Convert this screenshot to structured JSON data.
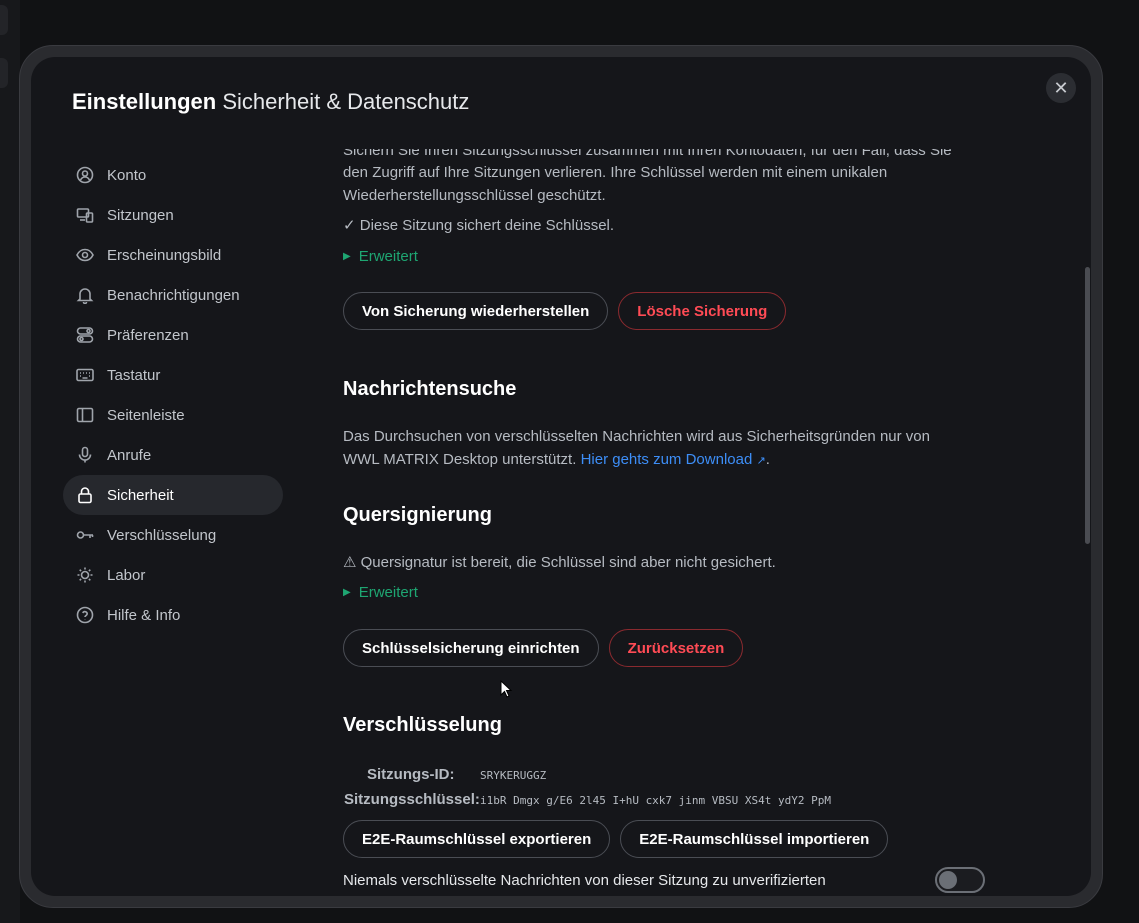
{
  "dialog": {
    "title_main": "Einstellungen",
    "title_sub": "Sicherheit & Datenschutz",
    "close_label": "✕"
  },
  "sidebar": {
    "items": [
      {
        "label": "Konto",
        "icon": "account-icon"
      },
      {
        "label": "Sitzungen",
        "icon": "devices-icon"
      },
      {
        "label": "Erscheinungsbild",
        "icon": "eye-icon"
      },
      {
        "label": "Benachrichtigungen",
        "icon": "bell-icon"
      },
      {
        "label": "Präferenzen",
        "icon": "preferences-icon"
      },
      {
        "label": "Tastatur",
        "icon": "keyboard-icon"
      },
      {
        "label": "Seitenleiste",
        "icon": "sidebar-icon"
      },
      {
        "label": "Anrufe",
        "icon": "microphone-icon"
      },
      {
        "label": "Sicherheit",
        "icon": "lock-icon",
        "active": true
      },
      {
        "label": "Verschlüsselung",
        "icon": "key-icon"
      },
      {
        "label": "Labor",
        "icon": "lightbulb-icon"
      },
      {
        "label": "Hilfe & Info",
        "icon": "help-icon"
      }
    ]
  },
  "backup": {
    "text_cut": "Sichern Sie Ihren Sitzungsschlüssel zusammen mit Ihren Kontodaten, für den Fall, dass Sie",
    "text_line2": "den Zugriff auf Ihre Sitzungen verlieren. Ihre Schlüssel werden mit einem unikalen",
    "text_line3": "Wiederherstellungsschlüssel geschützt.",
    "status": "✓ Diese Sitzung sichert deine Schlüssel.",
    "advanced": "Erweitert",
    "restore_button": "Von Sicherung wiederherstellen",
    "delete_button": "Lösche Sicherung"
  },
  "search": {
    "heading": "Nachrichtensuche",
    "text_line1": "Das Durchsuchen von verschlüsselten Nachrichten wird aus Sicherheitsgründen nur von",
    "text_line2": "WWL MATRIX Desktop unterstützt.",
    "link": "Hier gehts zum Download",
    "link_suffix": "."
  },
  "cross_signing": {
    "heading": "Quersignierung",
    "status": "⚠ Quersignatur ist bereit, die Schlüssel sind aber nicht gesichert.",
    "advanced": "Erweitert",
    "setup_button": "Schlüsselsicherung einrichten",
    "reset_button": "Zurücksetzen"
  },
  "encryption": {
    "heading": "Verschlüsselung",
    "session_id_label": "Sitzungs-ID:",
    "session_id_value": "SRYKERUGGZ",
    "session_key_label": "Sitzungsschlüssel:",
    "session_key_value": "i1bR Dmgx g/E6 2l45 I+hU cxk7 jinm VBSU XS4t ydY2 PpM",
    "export_button": "E2E-Raumschlüssel exportieren",
    "import_button": "E2E-Raumschlüssel importieren",
    "never_send_label": "Niemals verschlüsselte Nachrichten von dieser Sitzung zu unverifizierten",
    "never_send_toggle_on": false
  }
}
